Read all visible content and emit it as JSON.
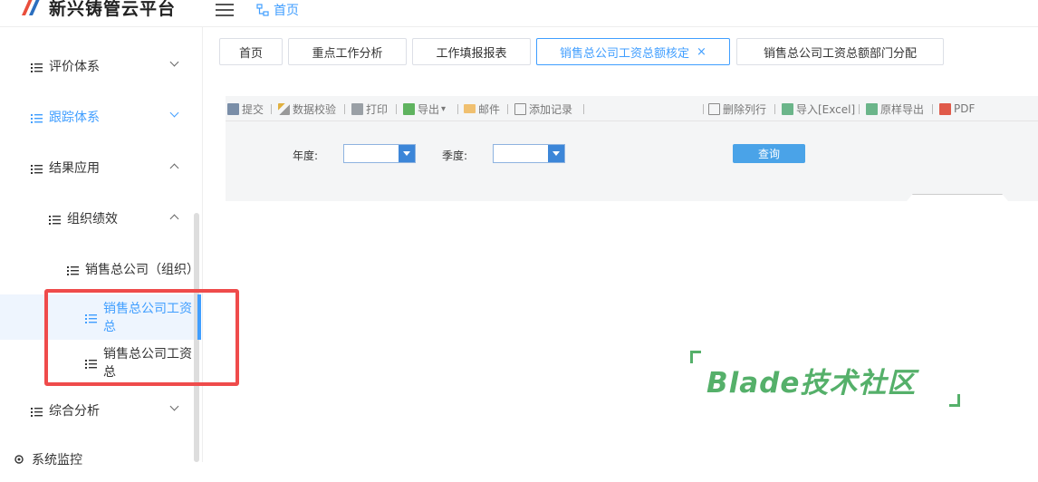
{
  "app": {
    "title": "新兴铸管云平台"
  },
  "header": {
    "home_crumb": "首页"
  },
  "sidebar": {
    "items": [
      {
        "label": "评价体系"
      },
      {
        "label": "跟踪体系"
      },
      {
        "label": "结果应用"
      },
      {
        "label": "组织绩效"
      },
      {
        "label": "销售总公司（组织）"
      },
      {
        "label": "销售总公司工资总"
      },
      {
        "label": "销售总公司工资总"
      },
      {
        "label": "综合分析"
      },
      {
        "label": "系统监控"
      }
    ]
  },
  "tabs": [
    {
      "label": "首页"
    },
    {
      "label": "重点工作分析"
    },
    {
      "label": "工作填报报表"
    },
    {
      "label": "销售总公司工资总额核定",
      "close": "×"
    },
    {
      "label": "销售总公司工资总额部门分配"
    }
  ],
  "toolbar": {
    "submit": "提交",
    "validate": "数据校验",
    "print": "打印",
    "export": "导出",
    "export_arrow": "▾",
    "mail": "邮件",
    "add_record": "添加记录",
    "delete_row": "删除列行",
    "import_excel": "导入[Excel]",
    "export_original": "原样导出",
    "pdf": "PDF"
  },
  "form": {
    "year_label": "年度:",
    "season_label": "季度:",
    "query_label": "查询"
  },
  "watermark": {
    "text": "Blade技术社区"
  },
  "colors": {
    "accent": "#409eff",
    "annotation": "#ef4b4b",
    "watermark": "#55b06a"
  }
}
